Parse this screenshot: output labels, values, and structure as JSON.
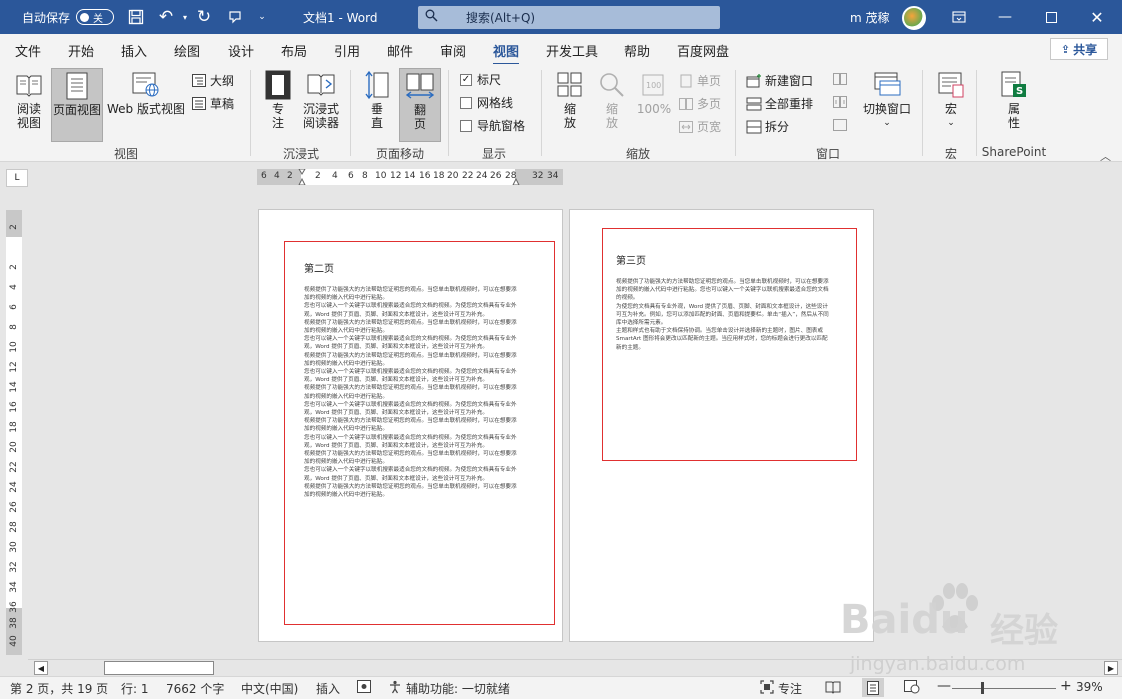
{
  "titlebar": {
    "autosave_label": "自动保存",
    "autosave_state": "关",
    "doc_title": "文档1  -  Word",
    "search_placeholder": "搜索(Alt+Q)",
    "user_name": "m 茂稼"
  },
  "menu": {
    "tabs": [
      "文件",
      "开始",
      "插入",
      "绘图",
      "设计",
      "布局",
      "引用",
      "邮件",
      "审阅",
      "视图",
      "开发工具",
      "帮助",
      "百度网盘"
    ],
    "active_tab": "视图",
    "share_label": "共享"
  },
  "ribbon": {
    "views": {
      "read_mode": [
        "阅读",
        "视图"
      ],
      "print_layout": "页面视图",
      "web_layout": "Web 版式视图",
      "outline": "大纲",
      "draft": "草稿",
      "group_label": "视图"
    },
    "immersive": {
      "focus": [
        "专",
        "注"
      ],
      "immersive_reader": [
        "沉浸式",
        "阅读器"
      ],
      "group_label": "沉浸式"
    },
    "page_movement": {
      "vertical": [
        "垂",
        "直"
      ],
      "side_to_side": [
        "翻",
        "页"
      ],
      "group_label": "页面移动"
    },
    "show": {
      "ruler": "标尺",
      "ruler_checked": true,
      "gridlines": "网格线",
      "navigation_pane": "导航窗格",
      "group_label": "显示"
    },
    "zoom": {
      "zoom": [
        "缩",
        "放"
      ],
      "zoom_disabled": [
        "缩",
        "放"
      ],
      "percent": "100%",
      "one_page": "单页",
      "multiple_pages": "多页",
      "page_width": "页宽",
      "group_label": "缩放"
    },
    "window": {
      "new_window": "新建窗口",
      "arrange_all": "全部重排",
      "split": "拆分",
      "switch_windows": "切换窗口",
      "group_label": "窗口"
    },
    "macros": {
      "macros": "宏",
      "group_label": "宏"
    },
    "sharepoint": {
      "properties": [
        "属",
        "性"
      ],
      "group_label": "SharePoint"
    }
  },
  "ruler": {
    "corner": "L",
    "h_ticks": [
      "6",
      "4",
      "2",
      "2",
      "4",
      "6",
      "8",
      "10",
      "12",
      "14",
      "16",
      "18",
      "20",
      "22",
      "24",
      "26",
      "28",
      "32",
      "34"
    ],
    "v_ticks": [
      "2",
      "2",
      "4",
      "6",
      "8",
      "10",
      "12",
      "14",
      "16",
      "18",
      "20",
      "22",
      "24",
      "26",
      "28",
      "30",
      "32",
      "34",
      "36",
      "38",
      "40"
    ]
  },
  "pages": {
    "left": {
      "title": "第二页",
      "paragraphs": [
        "视频提供了功能强大的方法帮助您证明您的观点。当您单击联机视频时，可以在想要添加的视频的嵌入代码中进行粘贴。",
        "您也可以键入一个关键字以联机搜索最适合您的文档的视频。为使您的文档具有专业外观，Word 提供了页眉、页脚、封面和文本框设计，这些设计可互为补充。",
        "视频提供了功能强大的方法帮助您证明您的观点。当您单击联机视频时，可以在想要添加的视频的嵌入代码中进行粘贴。",
        "您也可以键入一个关键字以联机搜索最适合您的文档的视频。为使您的文档具有专业外观，Word 提供了页眉、页脚、封面和文本框设计，这些设计可互为补充。",
        "视频提供了功能强大的方法帮助您证明您的观点。当您单击联机视频时，可以在想要添加的视频的嵌入代码中进行粘贴。",
        "您也可以键入一个关键字以联机搜索最适合您的文档的视频。为使您的文档具有专业外观，Word 提供了页眉、页脚、封面和文本框设计，这些设计可互为补充。",
        "视频提供了功能强大的方法帮助您证明您的观点。当您单击联机视频时，可以在想要添加的视频的嵌入代码中进行粘贴。",
        "您也可以键入一个关键字以联机搜索最适合您的文档的视频。为使您的文档具有专业外观，Word 提供了页眉、页脚、封面和文本框设计，这些设计可互为补充。",
        "视频提供了功能强大的方法帮助您证明您的观点。当您单击联机视频时，可以在想要添加的视频的嵌入代码中进行粘贴。",
        "您也可以键入一个关键字以联机搜索最适合您的文档的视频。为使您的文档具有专业外观，Word 提供了页眉、页脚、封面和文本框设计，这些设计可互为补充。",
        "视频提供了功能强大的方法帮助您证明您的观点。当您单击联机视频时，可以在想要添加的视频的嵌入代码中进行粘贴。",
        "您也可以键入一个关键字以联机搜索最适合您的文档的视频。为使您的文档具有专业外观，Word 提供了页眉、页脚、封面和文本框设计，这些设计可互为补充。",
        "视频提供了功能强大的方法帮助您证明您的观点。当您单击联机视频时，可以在想要添加的视频的嵌入代码中进行粘贴。"
      ]
    },
    "right": {
      "title": "第三页",
      "paragraphs": [
        "视频提供了功能强大的方法帮助您证明您的观点。当您单击联机视频时，可以在想要添加的视频的嵌入代码中进行粘贴。您也可以键入一个关键字以联机搜索最适合您的文档的视频。",
        "为使您的文档具有专业外观，Word 提供了页眉、页脚、封面和文本框设计，这些设计可互为补充。例如，您可以添加匹配的封面、页眉和提要栏。单击“插入”，然后从不同库中选择所需元素。",
        "主题和样式也有助于文档保持协调。当您单击设计并选择新的主题时，图片、图表或 SmartArt 图形将会更改以匹配新的主题。当应用样式时，您的标题会进行更改以匹配新的主题。"
      ]
    }
  },
  "statusbar": {
    "page": "第 2 页，共 19 页",
    "line": "行: 1",
    "words": "7662 个字",
    "language": "中文(中国)",
    "insert_mode": "插入",
    "accessibility": "辅助功能: 一切就绪",
    "focus": "专注",
    "zoom_percent": "39%"
  },
  "watermark": {
    "brand": "Baidu",
    "brand_cn": "经验",
    "url": "jingyan.baidu.com"
  },
  "colors": {
    "title_bar": "#2b579a",
    "page_border_red": "#e03030"
  }
}
